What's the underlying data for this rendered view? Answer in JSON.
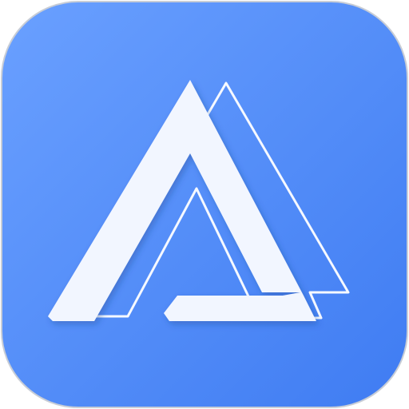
{
  "app_icon": {
    "name": "app-logo",
    "glyph": "stylized-letter-a-triangle-icon",
    "colors": {
      "background_top_left": "#6aa0ff",
      "background_bottom_right": "#3f7cf2",
      "border": "#c8cdd6",
      "glyph_fill": "#f2f6ff",
      "outline_stroke": "#ffffff"
    }
  }
}
